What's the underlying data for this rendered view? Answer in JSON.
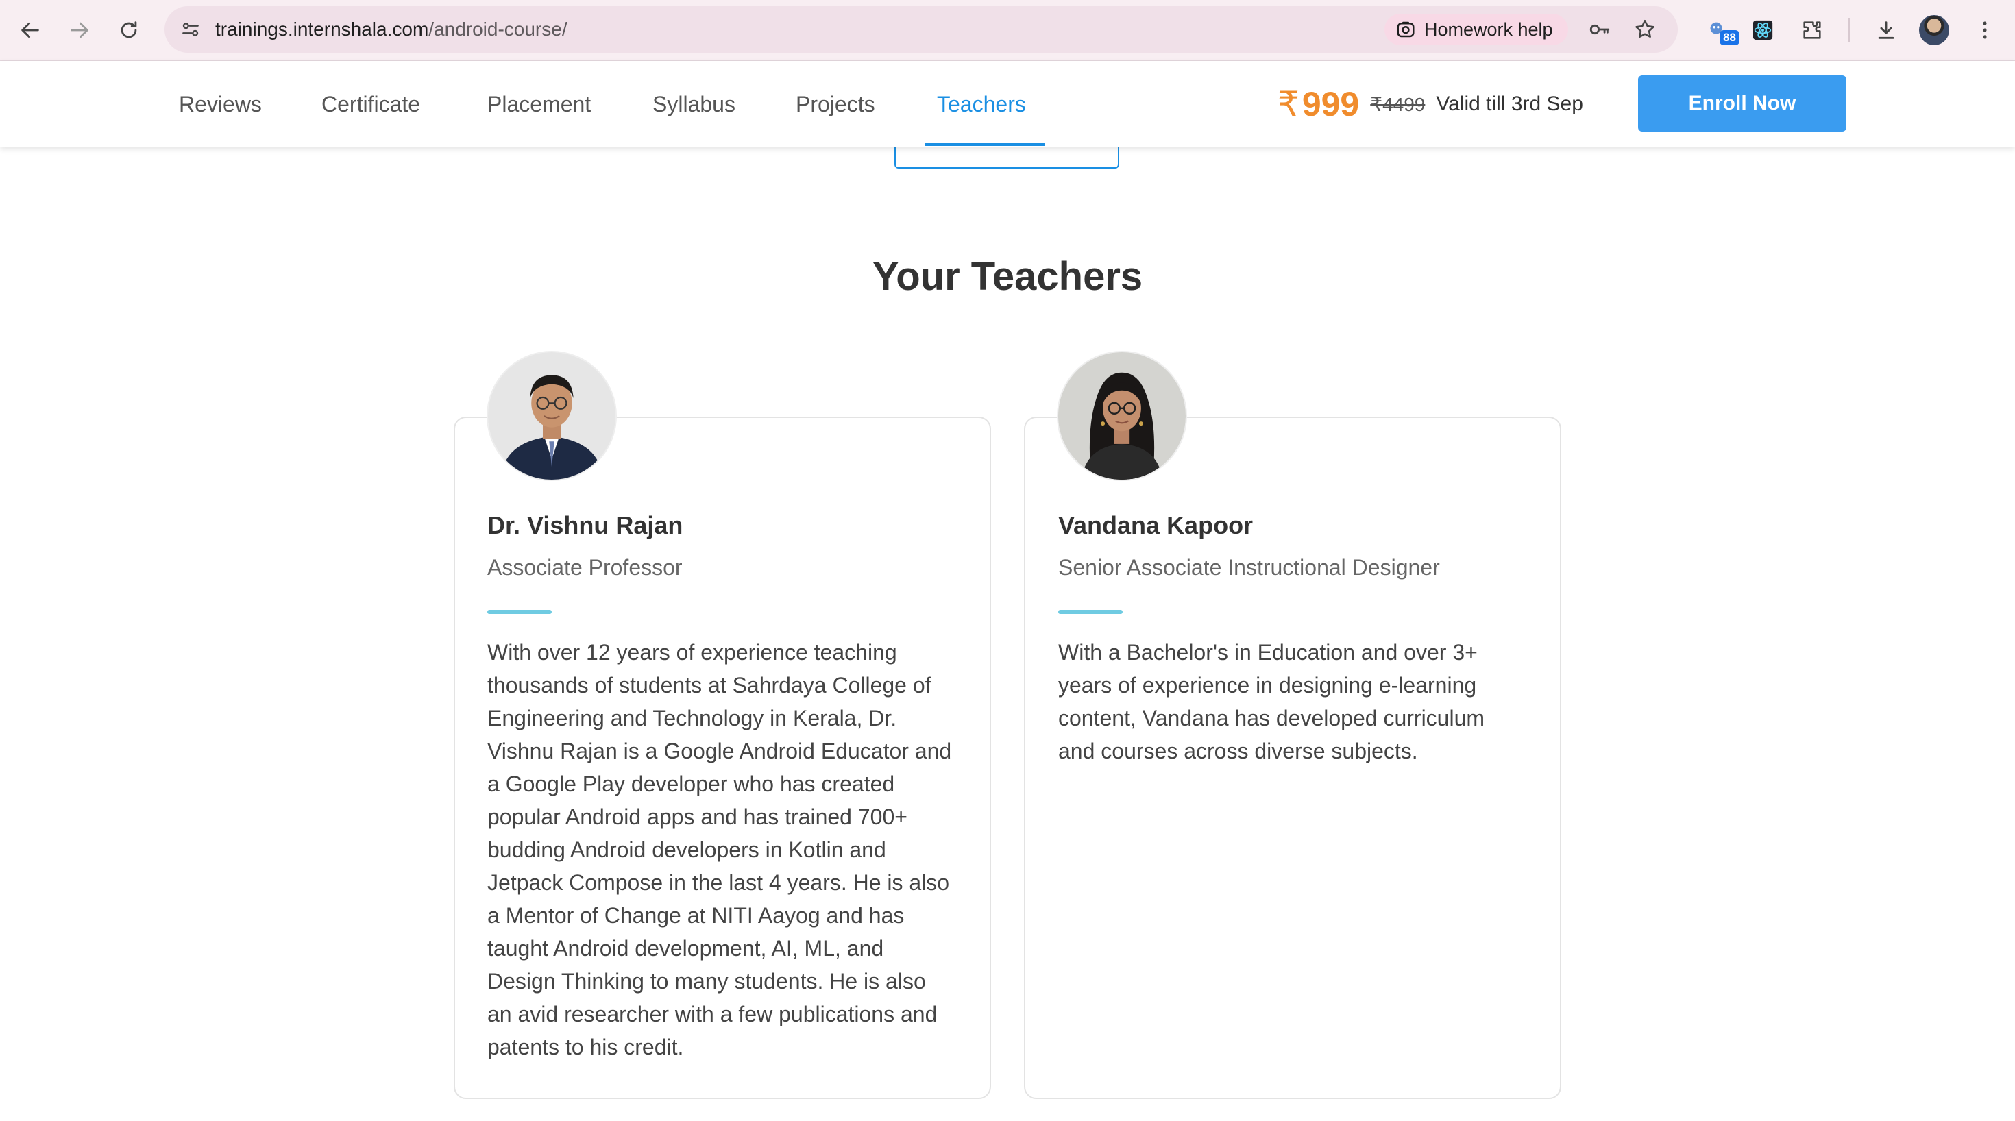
{
  "browser": {
    "url_host": "trainings.internshala.com",
    "url_path": "/android-course/",
    "homework_chip_label": "Homework help",
    "extension_badge": "88",
    "icons": [
      "back-icon",
      "forward-icon",
      "reload-icon",
      "site-info-icon",
      "lens-icon",
      "password-key-icon",
      "bookmark-star-icon",
      "extension-puzzle-icon",
      "react-devtools-icon",
      "download-icon",
      "menu-icon"
    ]
  },
  "nav": {
    "tabs": [
      {
        "label": "Reviews"
      },
      {
        "label": "Certificate"
      },
      {
        "label": "Placement"
      },
      {
        "label": "Syllabus"
      },
      {
        "label": "Projects"
      },
      {
        "label": "Teachers"
      }
    ],
    "active_tab": "Teachers",
    "price_currency_symbol": "₹",
    "price_current": "999",
    "price_original": "₹4499",
    "price_validity": "Valid till 3rd Sep",
    "enroll_label": "Enroll Now"
  },
  "section": {
    "title": "Your Teachers"
  },
  "teachers": [
    {
      "name": "Dr. Vishnu Rajan",
      "role": "Associate Professor",
      "bio": "With over 12 years of experience teaching thousands of students at Sahrdaya College of Engineering and Technology in Kerala, Dr. Vishnu Rajan is a Google Android Educator and a Google Play developer who has created popular Android apps and has trained 700+ budding Android developers in Kotlin and Jetpack Compose in the last 4 years. He is also a Mentor of Change at NITI Aayog and has taught Android development, AI, ML, and Design Thinking to many students. He is also an avid researcher with a few publications and patents to his credit."
    },
    {
      "name": "Vandana Kapoor",
      "role": "Senior Associate Instructional Designer",
      "bio": "With a Bachelor's in Education and over 3+ years of experience in designing e-learning content, Vandana has developed curriculum and courses across diverse subjects."
    }
  ],
  "colors": {
    "accent_blue": "#1a8fe3",
    "price_orange": "#f08c2d",
    "enroll_blue": "#3a9cf0",
    "card_accent": "#6fcbe2"
  }
}
